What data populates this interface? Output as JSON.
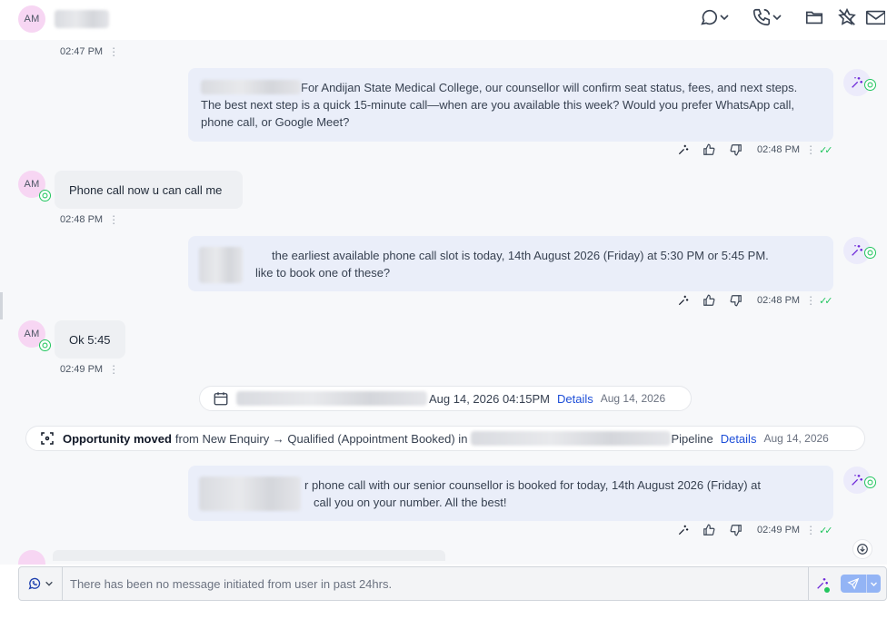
{
  "header": {
    "avatar_initials": "AM",
    "icons": [
      "chat-dropdown-icon",
      "phone-dropdown-icon",
      "folder-icon",
      "star-icon",
      "mail-icon"
    ]
  },
  "messages": [
    {
      "type": "incoming_time",
      "time": "02:47 PM"
    },
    {
      "type": "outgoing",
      "text": "For Andijan State Medical College, our counsellor will confirm seat status, fees, and next steps. The best next step is a quick 15-minute call—when are you available this week? Would you prefer WhatsApp call, phone call, or Google Meet?",
      "time": "02:48 PM"
    },
    {
      "type": "incoming",
      "initials": "AM",
      "text": "Phone call now u can call me",
      "time": "02:48 PM"
    },
    {
      "type": "outgoing",
      "line1": "the earliest available phone call slot is today, 14th August 2026 (Friday) at 5:30 PM or 5:45 PM.",
      "line2": "like to book one of these?",
      "time": "02:48 PM"
    },
    {
      "type": "incoming",
      "initials": "AM",
      "text": "Ok 5:45",
      "time": "02:49 PM"
    },
    {
      "type": "outgoing",
      "line1": "r phone call with our senior counsellor is booked for today, 14th August 2026 (Friday) at",
      "line2": "call you on your number. All the best!",
      "time": "02:49 PM"
    }
  ],
  "appointment": {
    "datetime": "Aug 14, 2026 04:15PM",
    "details": "Details",
    "date": "Aug 14, 2026"
  },
  "opportunity": {
    "title": "Opportunity moved",
    "text": "from New Enquiry → Qualified (Appointment Booked) in",
    "pipeline": "Pipeline",
    "details": "Details",
    "date": "Aug 14, 2026"
  },
  "composer": {
    "placeholder": "There has been no message initiated from user in past 24hrs."
  },
  "colors": {
    "accent": "#1d4ed8",
    "whatsapp": "#22c55e",
    "ai": "#6d28d9",
    "outgoing_bubble": "#eaeef9"
  }
}
